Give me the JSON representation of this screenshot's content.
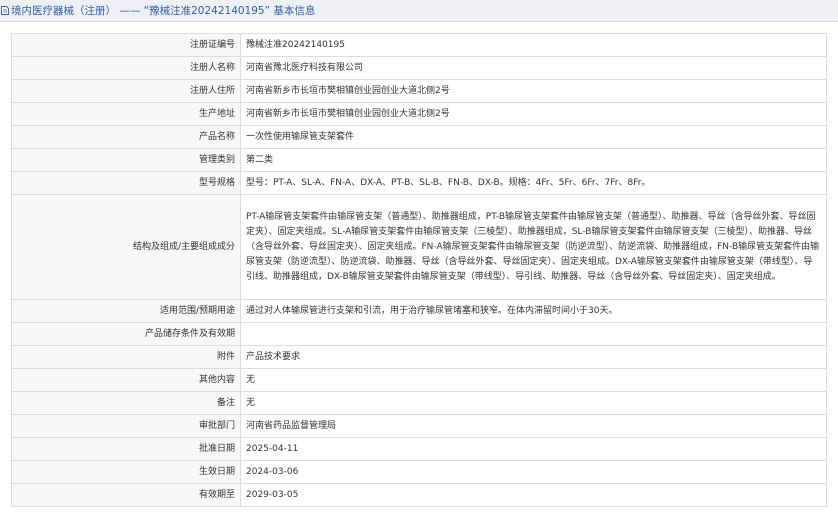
{
  "header": {
    "title": "境内医疗器械（注册） —— “豫械注准20242140195” 基本信息",
    "icon": "document-icon"
  },
  "fields": [
    {
      "label": "注册证编号",
      "value": "豫械注准20242140195"
    },
    {
      "label": "注册人名称",
      "value": "河南省豫北医疗科技有限公司"
    },
    {
      "label": "注册人住所",
      "value": "河南省新乡市长垣市樊相镇创业园创业大道北侧2号"
    },
    {
      "label": "生产地址",
      "value": "河南省新乡市长垣市樊相镇创业园创业大道北侧2号"
    },
    {
      "label": "产品名称",
      "value": "一次性使用输尿管支架套件"
    },
    {
      "label": "管理类别",
      "value": "第二类"
    },
    {
      "label": "型号规格",
      "value": "型号：PT-A、SL-A、FN-A、DX-A、PT-B、SL-B、FN-B、DX-B。规格：4Fr、5Fr、6Fr、7Fr、8Fr。"
    },
    {
      "label": "结构及组成/主要组成成分",
      "value": "PT-A输尿管支架套件由输尿管支架（普通型）、助推器组成，PT-B输尿管支架套件由输尿管支架（普通型）、助推器、导丝（含导丝外套、导丝固定夹）、固定夹组成。SL-A输尿管支架套件由输尿管支架（三棱型）、助推器组成，SL-B输尿管支架套件由输尿管支架（三棱型）、助推器、导丝（含导丝外套、导丝固定夹）、固定夹组成。FN-A输尿管支架套件由输尿管支架（防逆流型）、防逆流袋、助推器组成，FN-B输尿管支架套件由输尿管支架（防逆流型）、防逆流袋、助推器、导丝（含导丝外套、导丝固定夹）、固定夹组成。DX-A输尿管支架套件由输尿管支架（带线型）、导引线、助推器组成，DX-B输尿管支架套件由输尿管支架（带线型）、导引线、助推器、导丝（含导丝外套、导丝固定夹）、固定夹组成。"
    },
    {
      "label": "适用范围/预期用途",
      "value": "通过对人体输尿管进行支架和引流，用于治疗输尿管堵塞和狭窄。在体内滞留时间小于30天。"
    },
    {
      "label": "产品储存条件及有效期",
      "value": ""
    },
    {
      "label": "附件",
      "value": "产品技术要求"
    },
    {
      "label": "其他内容",
      "value": "无"
    },
    {
      "label": "备注",
      "value": "无"
    },
    {
      "label": "审批部门",
      "value": "河南省药品监督管理局"
    },
    {
      "label": "批准日期",
      "value": "2025-04-11"
    },
    {
      "label": "生效日期",
      "value": "2024-03-06"
    },
    {
      "label": "有效期至",
      "value": "2029-03-05"
    }
  ]
}
